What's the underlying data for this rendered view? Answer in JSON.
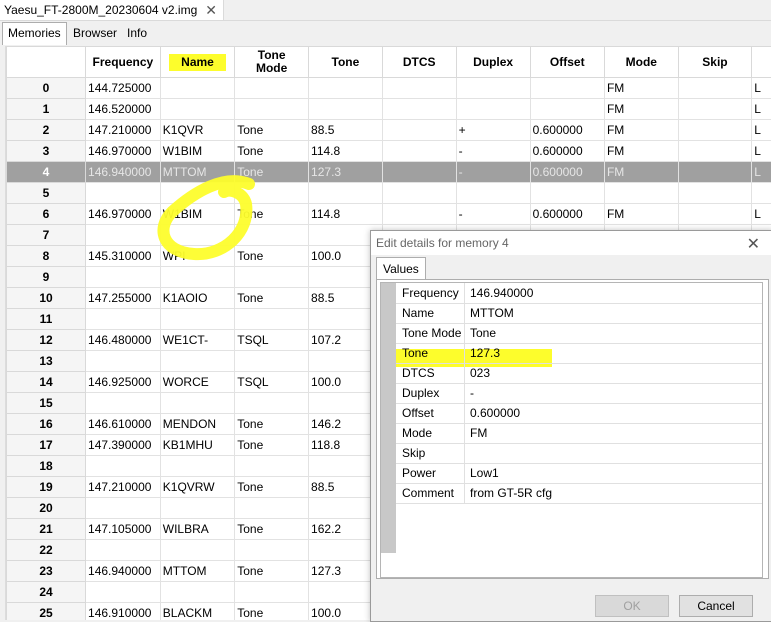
{
  "app": {
    "file_tab": "Yaesu_FT-2800M_20230604 v2.img",
    "close_glyph": "✕"
  },
  "subtabs": [
    "Memories",
    "Browser",
    "Info"
  ],
  "grid": {
    "columns": [
      "",
      "Frequency",
      "Name",
      "Tone\nMode",
      "Tone",
      "DTCS",
      "Duplex",
      "Offset",
      "Mode",
      "Skip",
      ""
    ],
    "rows": [
      [
        "0",
        "144.725000",
        "",
        "",
        "",
        "",
        "",
        "",
        "FM",
        "",
        "L"
      ],
      [
        "1",
        "146.520000",
        "",
        "",
        "",
        "",
        "",
        "",
        "FM",
        "",
        "L"
      ],
      [
        "2",
        "147.210000",
        "K1QVR",
        "Tone",
        "88.5",
        "",
        "+",
        "0.600000",
        "FM",
        "",
        "L"
      ],
      [
        "3",
        "146.970000",
        "W1BIM",
        "Tone",
        "114.8",
        "",
        "-",
        "0.600000",
        "FM",
        "",
        "L"
      ],
      [
        "4",
        "146.940000",
        "MTTOM",
        "Tone",
        "127.3",
        "",
        "-",
        "0.600000",
        "FM",
        "",
        "L"
      ],
      [
        "5",
        "",
        "",
        "",
        "",
        "",
        "",
        "",
        "",
        "",
        ""
      ],
      [
        "6",
        "146.970000",
        "W1BIM",
        "Tone",
        "114.8",
        "",
        "-",
        "0.600000",
        "FM",
        "",
        "L"
      ],
      [
        "7",
        "",
        "",
        "",
        "",
        "",
        "",
        "",
        "",
        "",
        ""
      ],
      [
        "8",
        "145.310000",
        "WPI",
        "Tone",
        "100.0",
        "",
        "",
        "",
        "",
        "",
        ""
      ],
      [
        "9",
        "",
        "",
        "",
        "",
        "",
        "",
        "",
        "",
        "",
        ""
      ],
      [
        "10",
        "147.255000",
        "K1AOIO",
        "Tone",
        "88.5",
        "",
        "",
        "",
        "",
        "",
        ""
      ],
      [
        "11",
        "",
        "",
        "",
        "",
        "",
        "",
        "",
        "",
        "",
        ""
      ],
      [
        "12",
        "146.480000",
        "WE1CT-",
        "TSQL",
        "107.2",
        "",
        "",
        "",
        "",
        "",
        ""
      ],
      [
        "13",
        "",
        "",
        "",
        "",
        "",
        "",
        "",
        "",
        "",
        ""
      ],
      [
        "14",
        "146.925000",
        "WORCE",
        "TSQL",
        "100.0",
        "",
        "",
        "",
        "",
        "",
        ""
      ],
      [
        "15",
        "",
        "",
        "",
        "",
        "",
        "",
        "",
        "",
        "",
        ""
      ],
      [
        "16",
        "146.610000",
        "MENDON",
        "Tone",
        "146.2",
        "",
        "",
        "",
        "",
        "",
        ""
      ],
      [
        "17",
        "147.390000",
        "KB1MHU",
        "Tone",
        "118.8",
        "",
        "",
        "",
        "",
        "",
        ""
      ],
      [
        "18",
        "",
        "",
        "",
        "",
        "",
        "",
        "",
        "",
        "",
        ""
      ],
      [
        "19",
        "147.210000",
        "K1QVRW",
        "Tone",
        "88.5",
        "",
        "",
        "",
        "",
        "",
        ""
      ],
      [
        "20",
        "",
        "",
        "",
        "",
        "",
        "",
        "",
        "",
        "",
        ""
      ],
      [
        "21",
        "147.105000",
        "WILBRA",
        "Tone",
        "162.2",
        "",
        "",
        "",
        "",
        "",
        ""
      ],
      [
        "22",
        "",
        "",
        "",
        "",
        "",
        "",
        "",
        "",
        "",
        ""
      ],
      [
        "23",
        "146.940000",
        "MTTOM",
        "Tone",
        "127.3",
        "",
        "",
        "",
        "",
        "",
        ""
      ],
      [
        "24",
        "",
        "",
        "",
        "",
        "",
        "",
        "",
        "",
        "",
        ""
      ],
      [
        "25",
        "146.910000",
        "BLACKM",
        "Tone",
        "100.0",
        "",
        "",
        "",
        "",
        "",
        ""
      ]
    ],
    "selected_index": 4
  },
  "dialog": {
    "title": "Edit details for memory 4",
    "tab": "Values",
    "fields": [
      {
        "key": "Frequency",
        "value": "146.940000"
      },
      {
        "key": "Name",
        "value": "MTTOM"
      },
      {
        "key": "Tone Mode",
        "value": "Tone"
      },
      {
        "key": "Tone",
        "value": "127.3"
      },
      {
        "key": "DTCS",
        "value": "023"
      },
      {
        "key": "Duplex",
        "value": "-"
      },
      {
        "key": "Offset",
        "value": "0.600000"
      },
      {
        "key": "Mode",
        "value": "FM"
      },
      {
        "key": "Skip",
        "value": ""
      },
      {
        "key": "Power",
        "value": "Low1"
      },
      {
        "key": "Comment",
        "value": "from GT-5R cfg"
      }
    ],
    "ok_label": "OK",
    "cancel_label": "Cancel"
  },
  "colors": {
    "highlight": "#fdfd2c",
    "selected_row": "#a0a0a0"
  }
}
